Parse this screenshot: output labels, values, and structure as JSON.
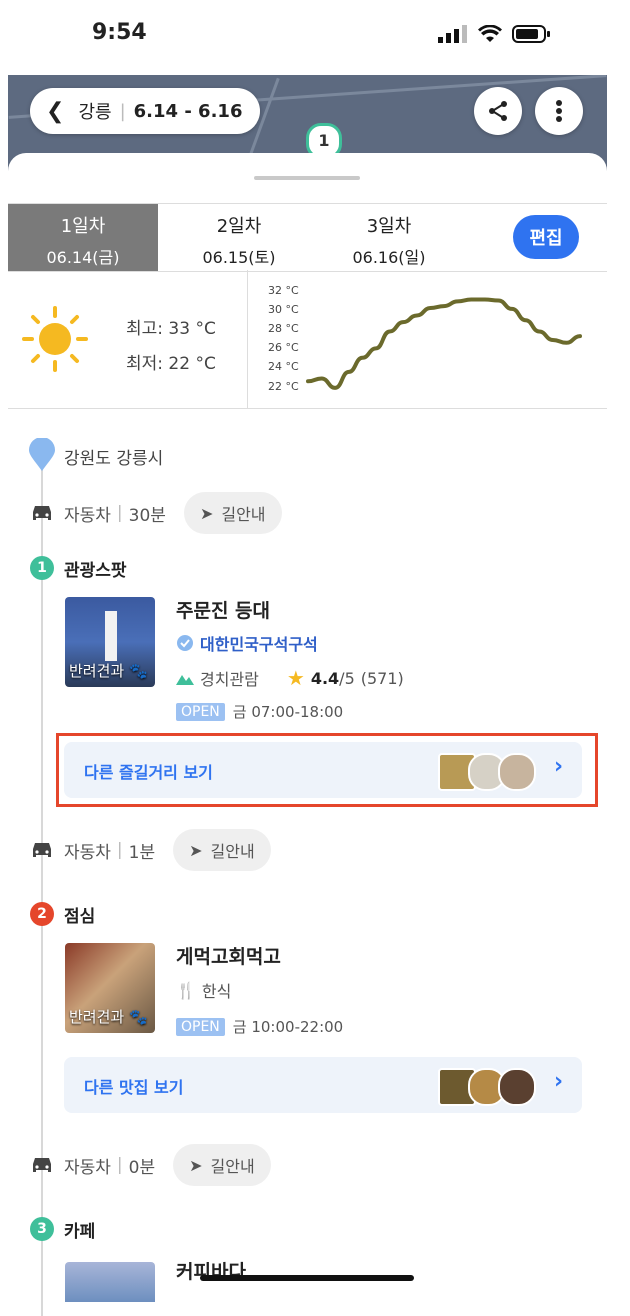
{
  "status": {
    "time": "9:54"
  },
  "header": {
    "title": "강릉",
    "dates": "6.14 - 6.16"
  },
  "tabs": [
    {
      "day": "1일차",
      "date": "06.14(금)",
      "active": true
    },
    {
      "day": "2일차",
      "date": "06.15(토)",
      "active": false
    },
    {
      "day": "3일차",
      "date": "06.16(일)",
      "active": false
    }
  ],
  "edit_label": "편집",
  "weather": {
    "high": "최고: 33 °C",
    "low": "최저: 22 °C",
    "y_ticks": [
      "32 °C",
      "30 °C",
      "28 °C",
      "26 °C",
      "24 °C",
      "22 °C"
    ]
  },
  "chart_data": {
    "type": "line",
    "y_ticks": [
      "32 °C",
      "30 °C",
      "28 °C",
      "26 °C",
      "24 °C",
      "22 °C"
    ],
    "ylim": [
      22,
      32
    ],
    "series": [
      {
        "values": [
          22.5,
          22.8,
          21.8,
          23.5,
          25,
          26,
          27.8,
          28.8,
          29.5,
          30.3,
          30.5,
          31,
          31.2,
          31.2,
          31.1,
          30.2,
          29,
          27.8,
          26.9,
          26.6,
          27.3
        ]
      }
    ]
  },
  "location": "강원도 강릉시",
  "legs": [
    {
      "mode": "자동차",
      "duration": "30분",
      "nav": "길안내"
    },
    {
      "mode": "자동차",
      "duration": "1분",
      "nav": "길안내"
    },
    {
      "mode": "자동차",
      "duration": "0분",
      "nav": "길안내"
    }
  ],
  "stops": [
    {
      "num": "1",
      "color": "#3fbf9a",
      "category": "관광스팟",
      "name": "주문진 등대",
      "badge": "대한민국구석구석",
      "type": "경치관람",
      "rating": "4.4",
      "rating_max": "/5",
      "reviews": "(571)",
      "pet": "반려견과",
      "open": "OPEN",
      "hours": "금 07:00-18:00",
      "more": "다른 즐길거리 보기"
    },
    {
      "num": "2",
      "color": "#e5462b",
      "category": "점심",
      "name": "게먹고회먹고",
      "type": "한식",
      "pet": "반려견과",
      "open": "OPEN",
      "hours": "금 10:00-22:00",
      "more": "다른 맛집 보기"
    },
    {
      "num": "3",
      "color": "#3fbf9a",
      "category": "카페",
      "name": "커피바다"
    }
  ],
  "colors": {
    "accent": "#2f73f0",
    "highlight_border": "#e5462b"
  }
}
